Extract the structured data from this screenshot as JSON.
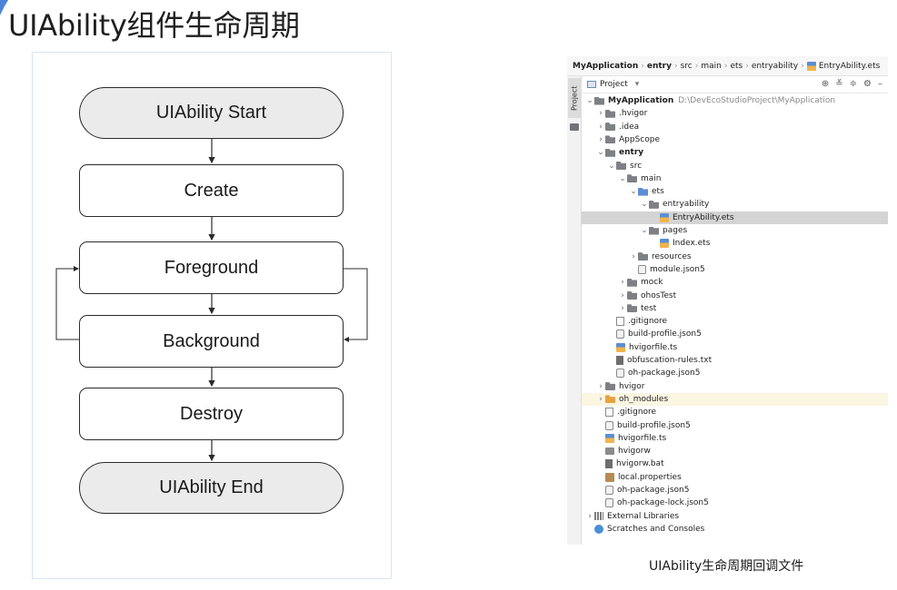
{
  "title": "UIAbility组件生命周期",
  "flow": {
    "start": "UIAbility Start",
    "create": "Create",
    "foreground": "Foreground",
    "background": "Background",
    "destroy": "Destroy",
    "end": "UIAbility End"
  },
  "ide": {
    "breadcrumbs": [
      "MyApplication",
      "entry",
      "src",
      "main",
      "ets",
      "entryability",
      "EntryAbility.ets"
    ],
    "side_tab": "Project",
    "toolbar": {
      "project_selector": "Project",
      "dropdown": "▾",
      "icons": [
        "crosshair-icon",
        "expand-all-icon",
        "collapse-all-icon",
        "gear-icon",
        "minimize-icon"
      ]
    },
    "tree": [
      {
        "depth": 0,
        "chevron": "⌄",
        "icon": "module",
        "label": "MyApplication",
        "path": "D:\\DevEcoStudioProject\\MyApplication",
        "bold": true
      },
      {
        "depth": 1,
        "chevron": "›",
        "icon": "folder",
        "label": ".hvigor"
      },
      {
        "depth": 1,
        "chevron": "›",
        "icon": "folder",
        "label": ".idea"
      },
      {
        "depth": 1,
        "chevron": "›",
        "icon": "folder",
        "label": "AppScope"
      },
      {
        "depth": 1,
        "chevron": "⌄",
        "icon": "module",
        "label": "entry",
        "bold": true
      },
      {
        "depth": 2,
        "chevron": "⌄",
        "icon": "folder",
        "label": "src"
      },
      {
        "depth": 3,
        "chevron": "⌄",
        "icon": "folder",
        "label": "main"
      },
      {
        "depth": 4,
        "chevron": "⌄",
        "icon": "folder-blue",
        "label": "ets"
      },
      {
        "depth": 5,
        "chevron": "⌄",
        "icon": "folder",
        "label": "entryability"
      },
      {
        "depth": 6,
        "chevron": "",
        "icon": "ets",
        "label": "EntryAbility.ets",
        "selected": true
      },
      {
        "depth": 5,
        "chevron": "⌄",
        "icon": "folder",
        "label": "pages"
      },
      {
        "depth": 6,
        "chevron": "",
        "icon": "ets",
        "label": "Index.ets"
      },
      {
        "depth": 4,
        "chevron": "›",
        "icon": "folder",
        "label": "resources"
      },
      {
        "depth": 4,
        "chevron": "",
        "icon": "json",
        "label": "module.json5"
      },
      {
        "depth": 3,
        "chevron": "›",
        "icon": "folder",
        "label": "mock"
      },
      {
        "depth": 3,
        "chevron": "›",
        "icon": "folder",
        "label": "ohosTest"
      },
      {
        "depth": 3,
        "chevron": "›",
        "icon": "folder",
        "label": "test"
      },
      {
        "depth": 2,
        "chevron": "",
        "icon": "git",
        "label": ".gitignore"
      },
      {
        "depth": 2,
        "chevron": "",
        "icon": "json",
        "label": "build-profile.json5"
      },
      {
        "depth": 2,
        "chevron": "",
        "icon": "ets",
        "label": "hvigorfile.ts"
      },
      {
        "depth": 2,
        "chevron": "",
        "icon": "txt",
        "label": "obfuscation-rules.txt"
      },
      {
        "depth": 2,
        "chevron": "",
        "icon": "json",
        "label": "oh-package.json5"
      },
      {
        "depth": 1,
        "chevron": "›",
        "icon": "folder",
        "label": "hvigor"
      },
      {
        "depth": 1,
        "chevron": "›",
        "icon": "folder-orange",
        "label": "oh_modules",
        "highlight": true
      },
      {
        "depth": 1,
        "chevron": "",
        "icon": "git",
        "label": ".gitignore"
      },
      {
        "depth": 1,
        "chevron": "",
        "icon": "json",
        "label": "build-profile.json5"
      },
      {
        "depth": 1,
        "chevron": "",
        "icon": "ets",
        "label": "hvigorfile.ts"
      },
      {
        "depth": 1,
        "chevron": "",
        "icon": "bin",
        "label": "hvigorw"
      },
      {
        "depth": 1,
        "chevron": "",
        "icon": "txt",
        "label": "hvigorw.bat"
      },
      {
        "depth": 1,
        "chevron": "",
        "icon": "props",
        "label": "local.properties"
      },
      {
        "depth": 1,
        "chevron": "",
        "icon": "json",
        "label": "oh-package.json5"
      },
      {
        "depth": 1,
        "chevron": "",
        "icon": "json",
        "label": "oh-package-lock.json5"
      },
      {
        "depth": 0,
        "chevron": "›",
        "icon": "libs",
        "label": "External Libraries"
      },
      {
        "depth": 0,
        "chevron": "",
        "icon": "scratch",
        "label": "Scratches and Consoles"
      }
    ]
  },
  "caption": "UIAbility生命周期回调文件",
  "colors": {
    "accent": "#4a90d6",
    "terminal_fill": "#ebebeb",
    "selection": "#d4d4d4",
    "highlight_row": "#fbf6e2"
  }
}
